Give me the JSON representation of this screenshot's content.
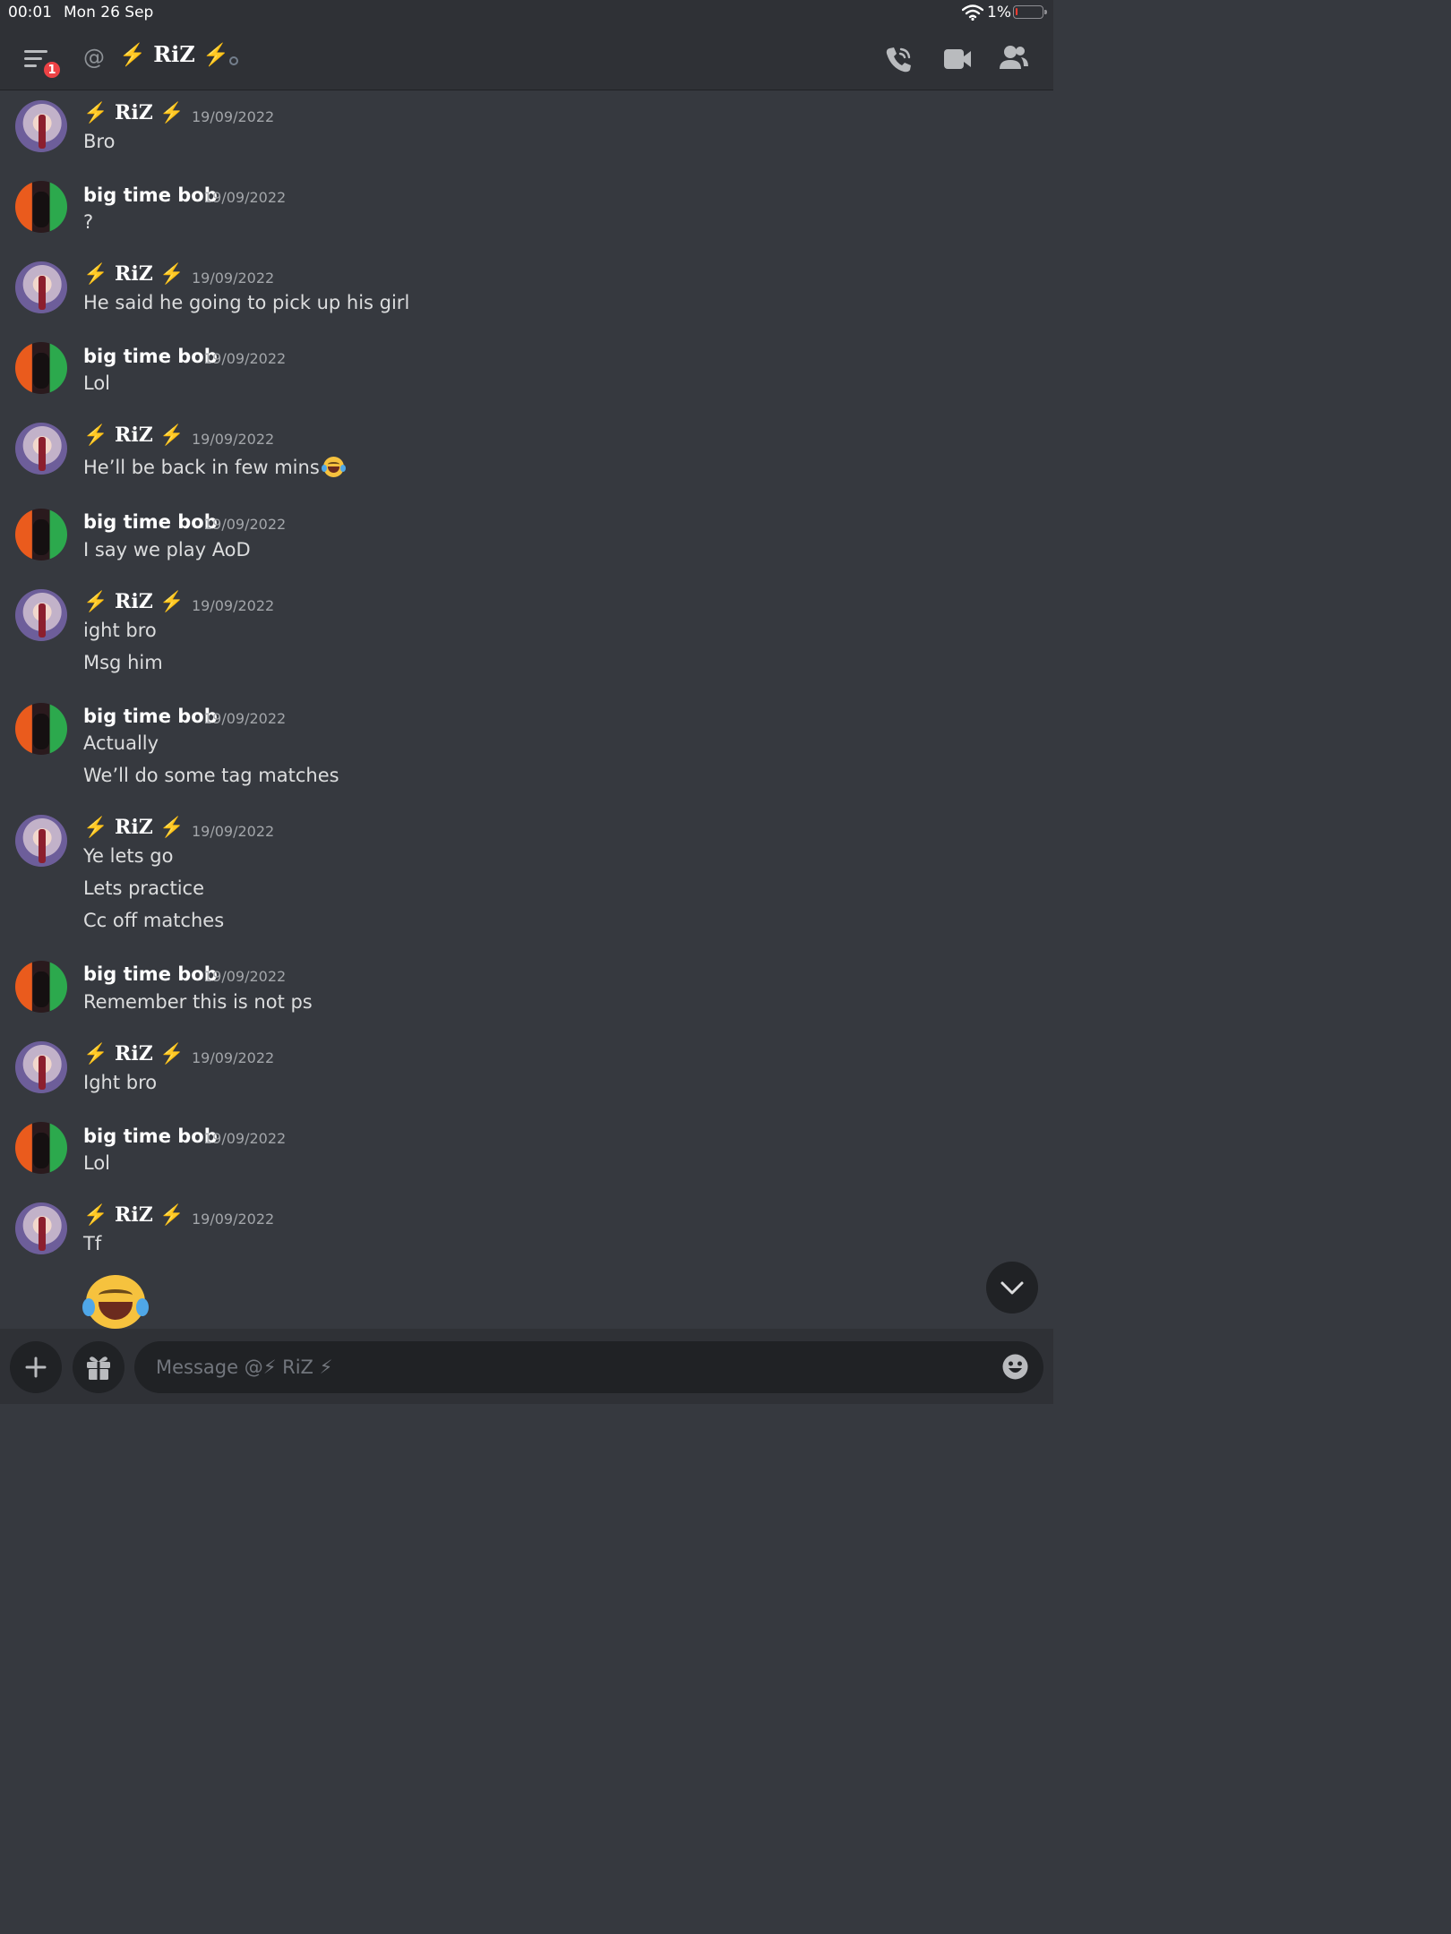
{
  "status_bar": {
    "time": "00:01",
    "date": "Mon 26 Sep",
    "battery": "1%"
  },
  "header": {
    "unread_badge": "1",
    "at_symbol": "@",
    "channel_name": "⚡ RiZ ⚡",
    "icons": [
      "hamburger-menu-icon",
      "phone-call-icon",
      "video-camera-icon",
      "member-list-icon"
    ]
  },
  "messages": [
    {
      "author": "⚡ RiZ ⚡",
      "timestamp": "19/09/2022",
      "lines": [
        "Bro"
      ]
    },
    {
      "author": "big time bob",
      "timestamp": "19/09/2022",
      "lines": [
        "?"
      ]
    },
    {
      "author": "⚡ RiZ ⚡",
      "timestamp": "19/09/2022",
      "lines": [
        "He said he going to pick up his girl"
      ]
    },
    {
      "author": "big time bob",
      "timestamp": "19/09/2022",
      "lines": [
        "Lol"
      ]
    },
    {
      "author": "⚡ RiZ ⚡",
      "timestamp": "19/09/2022",
      "lines": [
        "He’ll be back in few mins"
      ],
      "emoji": "face-with-tears-of-joy"
    },
    {
      "author": "big time bob",
      "timestamp": "19/09/2022",
      "lines": [
        "I say we play AoD"
      ]
    },
    {
      "author": "⚡ RiZ ⚡",
      "timestamp": "19/09/2022",
      "lines": [
        "ight bro",
        "Msg him"
      ]
    },
    {
      "author": "big time bob",
      "timestamp": "19/09/2022",
      "lines": [
        "Actually",
        "We’ll do some tag matches"
      ]
    },
    {
      "author": "⚡ RiZ ⚡",
      "timestamp": "19/09/2022",
      "lines": [
        "Ye lets go",
        "Lets practice",
        "Cc off matches"
      ]
    },
    {
      "author": "big time bob",
      "timestamp": "19/09/2022",
      "lines": [
        "Remember this is not ps"
      ]
    },
    {
      "author": "⚡ RiZ ⚡",
      "timestamp": "19/09/2022",
      "lines": [
        "Ight bro"
      ]
    },
    {
      "author": "big time bob",
      "timestamp": "19/09/2022",
      "lines": [
        "Lol"
      ]
    },
    {
      "author": "⚡ RiZ ⚡",
      "timestamp": "19/09/2022",
      "lines": [
        "Tf"
      ],
      "big_emoji": "face-with-tears-of-joy"
    }
  ],
  "composer": {
    "placeholder": "Message @⚡ RiZ ⚡"
  },
  "colors": {
    "background": "#36393f",
    "header": "#2f3136",
    "input": "#202225",
    "badge": "#ed4245",
    "username": "#ffffff",
    "timestamp": "#a3a6aa",
    "text": "#dcddde"
  }
}
